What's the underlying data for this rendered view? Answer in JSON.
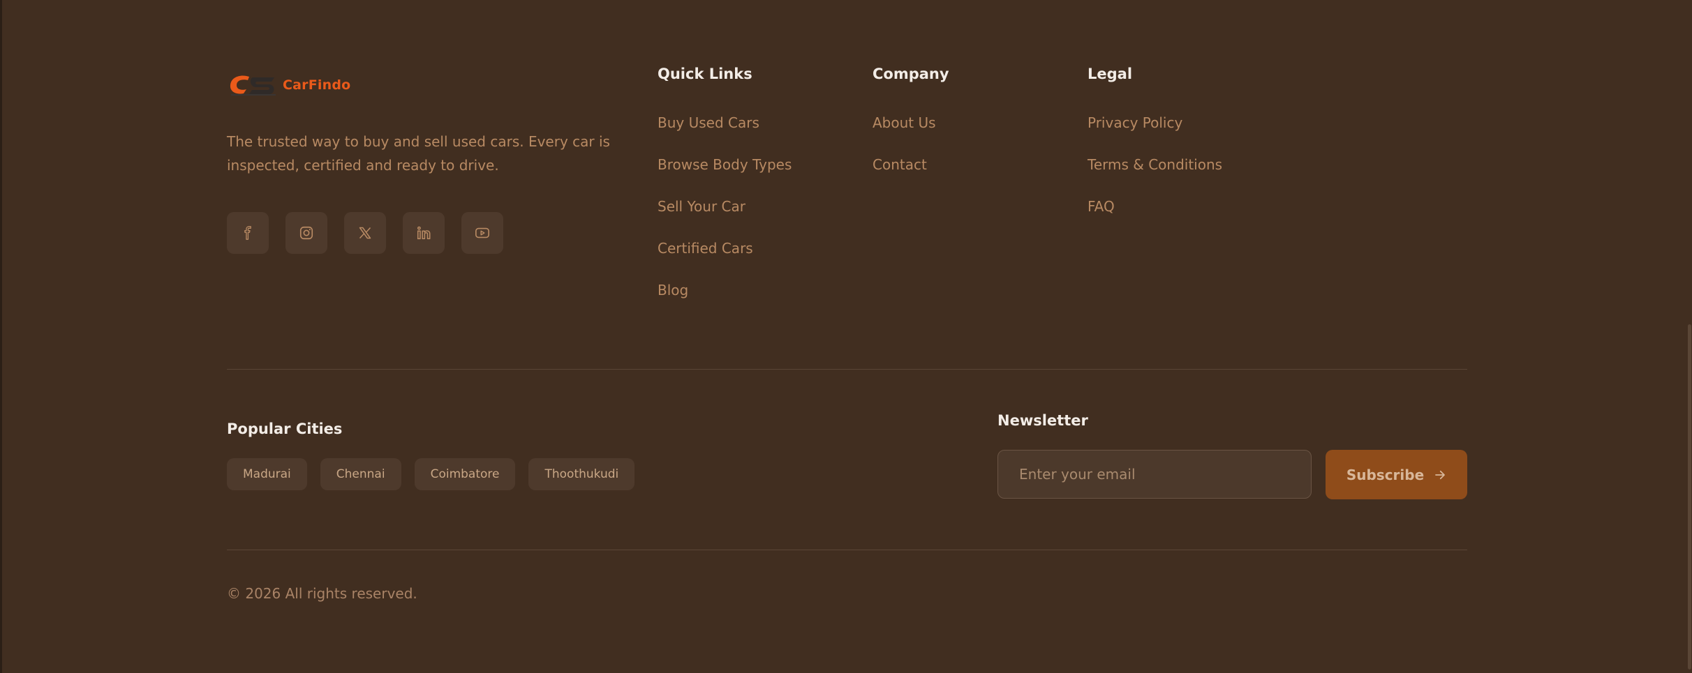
{
  "brand": {
    "name": "CarFindo",
    "tagline": "The trusted way to buy and sell used cars. Every car is inspected, certified and ready to drive.",
    "accent_color": "#ea5a1a"
  },
  "socials": [
    {
      "icon": "facebook-icon"
    },
    {
      "icon": "instagram-icon"
    },
    {
      "icon": "x-twitter-icon"
    },
    {
      "icon": "linkedin-icon"
    },
    {
      "icon": "youtube-icon"
    }
  ],
  "quick_links": {
    "title": "Quick Links",
    "items": [
      "Buy Used Cars",
      "Browse Body Types",
      "Sell Your Car",
      "Certified Cars",
      "Blog"
    ]
  },
  "company": {
    "title": "Company",
    "items": [
      "About Us",
      "Contact"
    ]
  },
  "legal": {
    "title": "Legal",
    "items": [
      "Privacy Policy",
      "Terms & Conditions",
      "FAQ"
    ]
  },
  "popular_cities": {
    "title": "Popular Cities",
    "items": [
      "Madurai",
      "Chennai",
      "Coimbatore",
      "Thoothukudi"
    ]
  },
  "newsletter": {
    "title": "Newsletter",
    "placeholder": "Enter your email",
    "value": "",
    "button_label": "Subscribe",
    "button_color": "#8f4c1a"
  },
  "copyright": "© 2026 All rights reserved.",
  "colors": {
    "background": "#412e20",
    "heading": "#f3ede7",
    "link": "#b88a63"
  }
}
